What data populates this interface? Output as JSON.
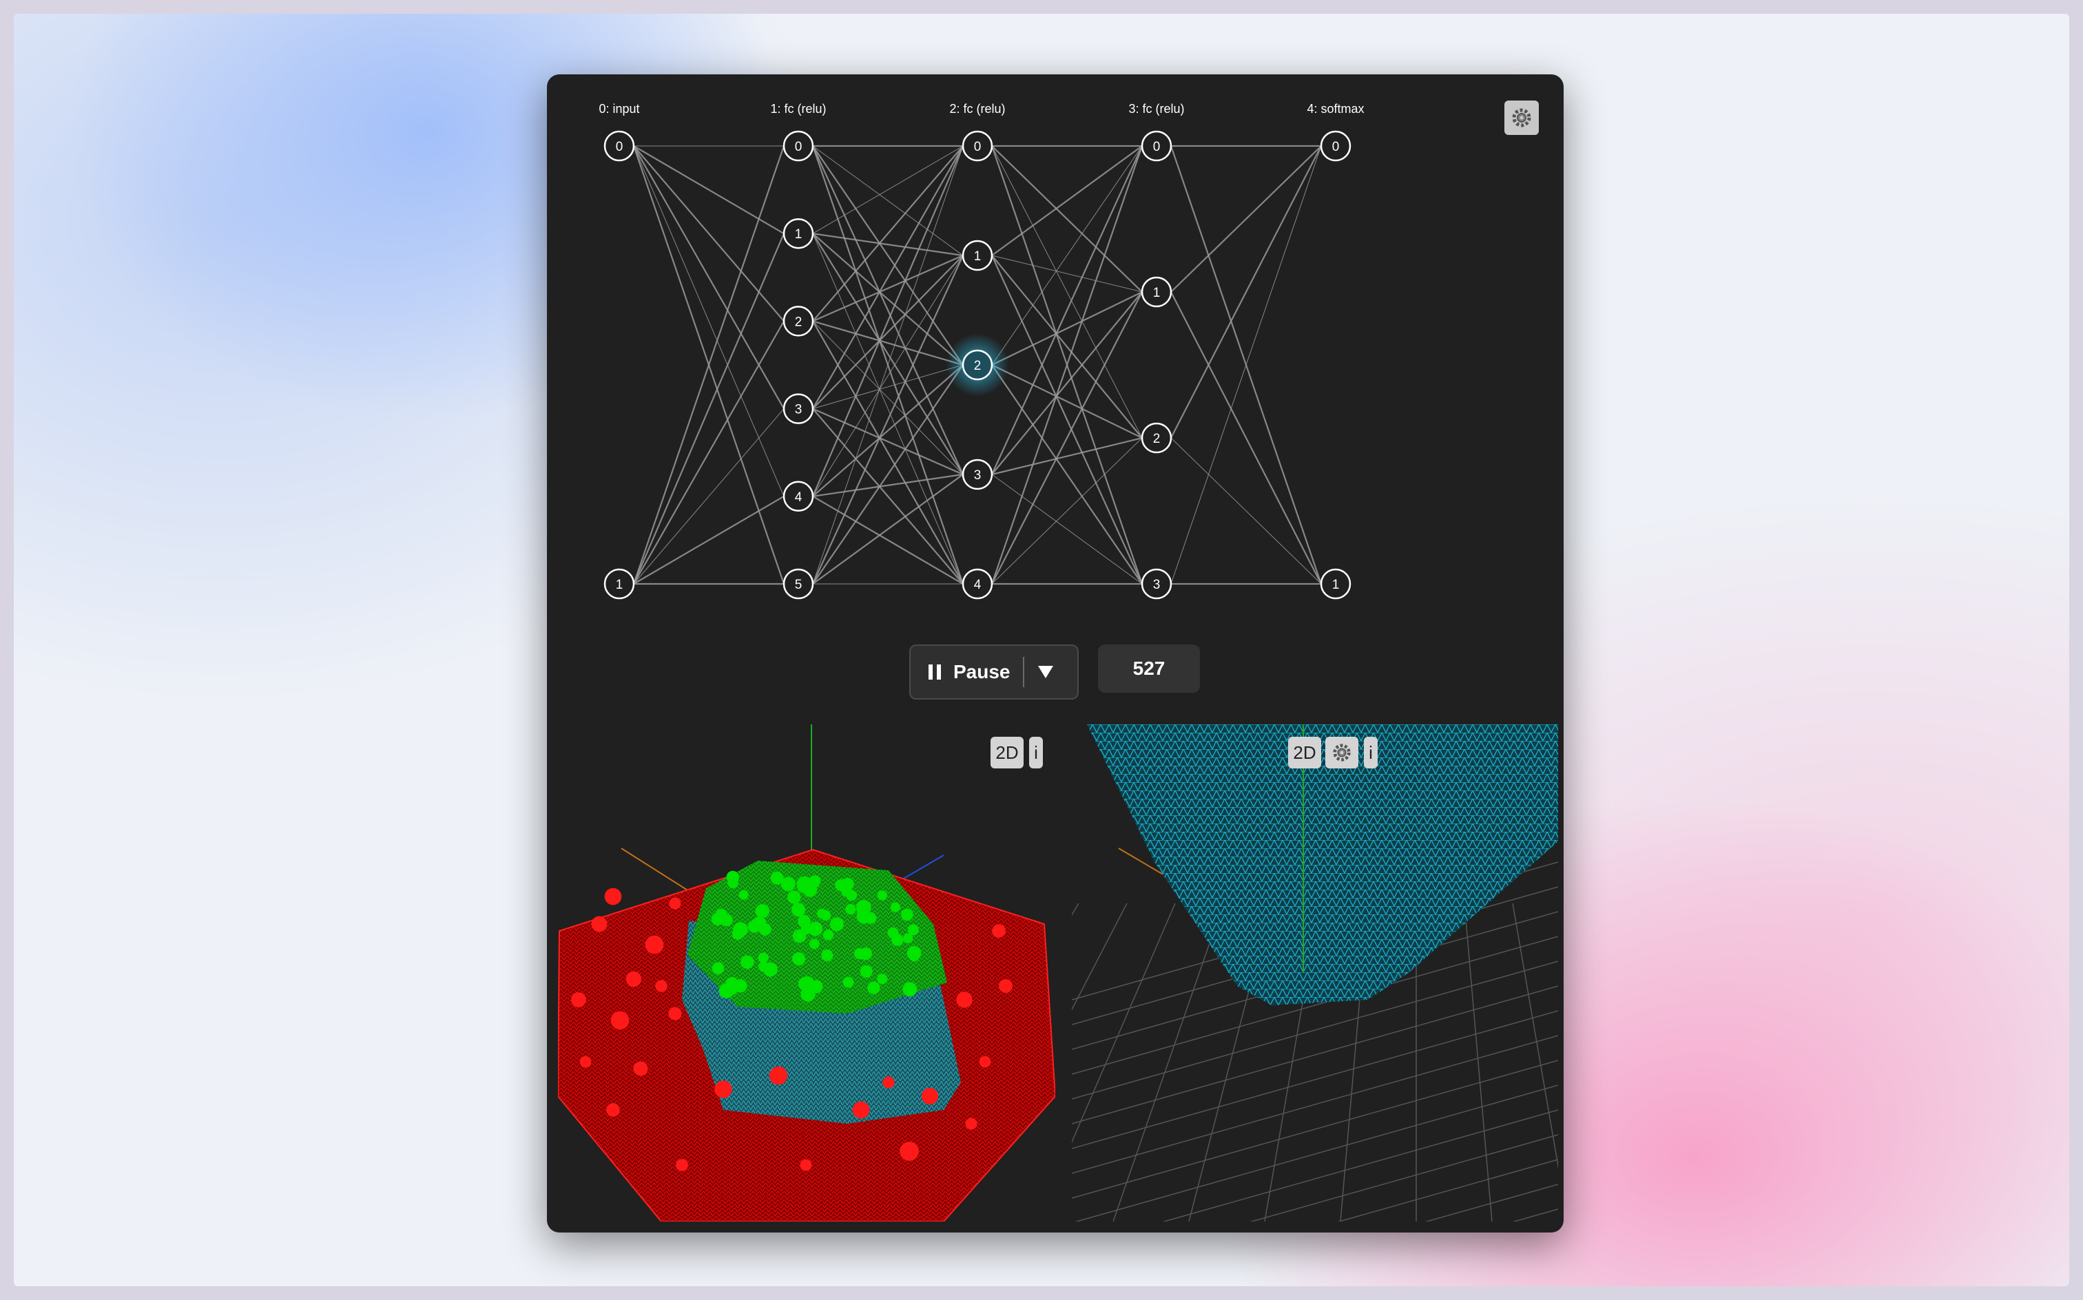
{
  "network": {
    "layers": [
      {
        "label": "0: input",
        "nodes": [
          "0",
          "1"
        ]
      },
      {
        "label": "1: fc (relu)",
        "nodes": [
          "0",
          "1",
          "2",
          "3",
          "4",
          "5"
        ]
      },
      {
        "label": "2: fc (relu)",
        "nodes": [
          "0",
          "1",
          "2",
          "3",
          "4"
        ]
      },
      {
        "label": "3: fc (relu)",
        "nodes": [
          "0",
          "1",
          "2",
          "3"
        ]
      },
      {
        "label": "4: softmax",
        "nodes": [
          "0",
          "1"
        ]
      }
    ],
    "highlighted_node": {
      "layer": 2,
      "node": 2
    },
    "colors": {
      "edge": "#9a9a9a",
      "node_stroke": "#ffffff",
      "highlight": "#2ec8f0"
    }
  },
  "settings_icon": "gear-icon",
  "controls": {
    "pause_label": "Pause",
    "pause_icon": "pause-icon",
    "dropdown_icon": "caret-down-icon",
    "iteration": "527"
  },
  "left_view": {
    "mode_button": "2D",
    "info_button": "i",
    "colors": {
      "class_a": "#00e400",
      "class_b": "#e00000",
      "surface": "#20a0b0"
    }
  },
  "right_view": {
    "mode_button": "2D",
    "settings_icon": "gear-icon",
    "info_button": "i",
    "colors": {
      "surface": "#19a9c8",
      "grid": "#555555"
    }
  }
}
